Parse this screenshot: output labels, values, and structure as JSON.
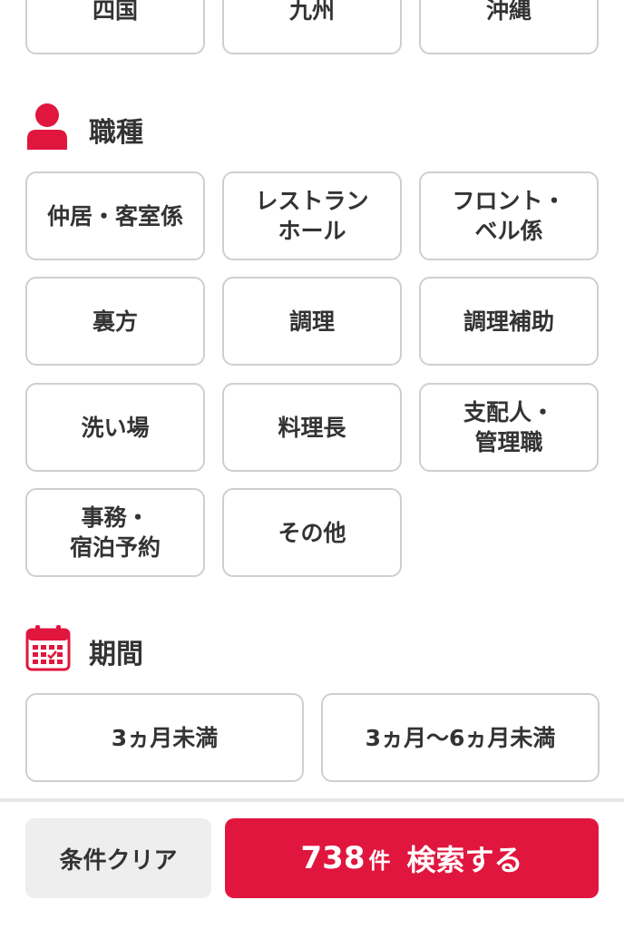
{
  "region": {
    "row": [
      "四国",
      "九州",
      "沖縄"
    ]
  },
  "job": {
    "title": "職種",
    "icon": "person-icon",
    "options": [
      "仲居・客室係",
      "レストラン\nホール",
      "フロント・\nベル係",
      "裏方",
      "調理",
      "調理補助",
      "洗い場",
      "料理長",
      "支配人・\n管理職",
      "事務・\n宿泊予約",
      "その他"
    ]
  },
  "period": {
    "title": "期間",
    "icon": "calendar-icon",
    "options": [
      "3ヵ月未満",
      "3ヵ月〜6ヵ月未満"
    ]
  },
  "footer": {
    "clear_label": "条件クリア",
    "result_count": "738",
    "result_unit": "件",
    "search_label": "検索する"
  },
  "colors": {
    "accent": "#e0163e",
    "border": "#cfcfcf"
  }
}
